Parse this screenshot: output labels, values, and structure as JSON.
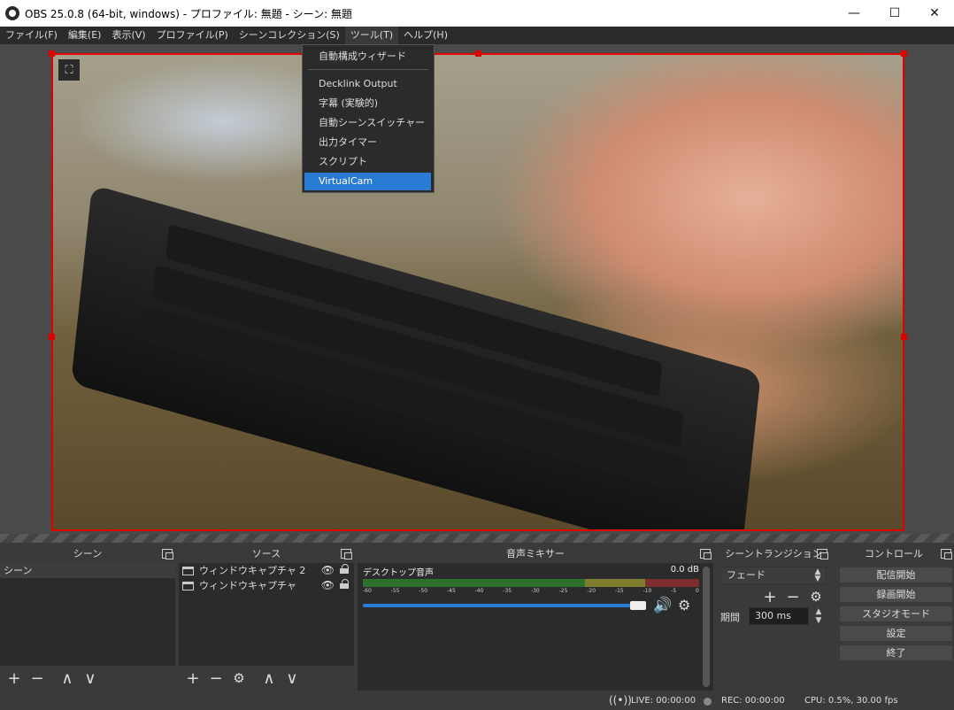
{
  "window": {
    "title": "OBS 25.0.8 (64-bit, windows) - プロファイル: 無題 - シーン: 無題",
    "minimize": "—",
    "maximize": "☐",
    "close": "✕"
  },
  "menu": [
    "ファイル(F)",
    "編集(E)",
    "表示(V)",
    "プロファイル(P)",
    "シーンコレクション(S)",
    "ツール(T)",
    "ヘルプ(H)"
  ],
  "tools_menu": {
    "items": [
      "自動構成ウィザード",
      "Decklink Output",
      "字幕 (実験的)",
      "自動シーンスイッチャー",
      "出力タイマー",
      "スクリプト",
      "VirtualCam"
    ],
    "selected": "VirtualCam"
  },
  "panels": {
    "scenes": {
      "title": "シーン",
      "items": [
        "シーン"
      ]
    },
    "sources": {
      "title": "ソース",
      "items": [
        "ウィンドウキャプチャ 2",
        "ウィンドウキャプチャ"
      ]
    },
    "mixer": {
      "title": "音声ミキサー",
      "channel": "デスクトップ音声",
      "db": "0.0 dB",
      "ticks": [
        "-60",
        "-55",
        "-50",
        "-45",
        "-40",
        "-35",
        "-30",
        "-25",
        "-20",
        "-15",
        "-10",
        "-5",
        "0"
      ],
      "volume_fraction": 1.0
    },
    "transitions": {
      "title": "シーントランジション",
      "type": "フェード",
      "duration_label": "期間",
      "duration": "300 ms"
    },
    "controls": {
      "title": "コントロール",
      "buttons": [
        "配信開始",
        "録画開始",
        "スタジオモード",
        "設定",
        "終了"
      ]
    }
  },
  "status": {
    "live": "LIVE: 00:00:00",
    "rec": "REC: 00:00:00",
    "cpu": "CPU: 0.5%, 30.00 fps"
  },
  "icons": {
    "add": "+",
    "remove": "−",
    "up": "∧",
    "down": "∨",
    "gear": "⚙",
    "eye": "👁",
    "speaker": "🔊",
    "fullscreen": "⛶"
  },
  "colors": {
    "selection_border": "#e00000",
    "accent": "#2a7bd4",
    "bg": "#2b2b2b"
  }
}
